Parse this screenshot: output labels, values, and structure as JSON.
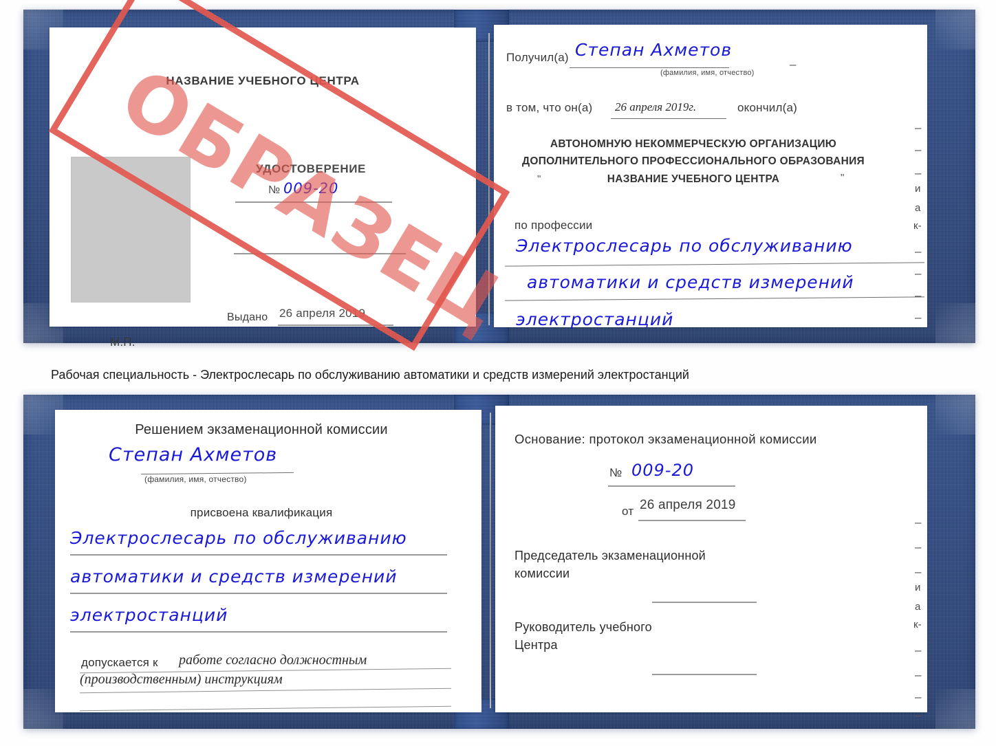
{
  "meta": {
    "stamp_color": "#e2584f",
    "cover_color": "#27478a",
    "ink_color": "#1a1ad6",
    "photo_placeholder_color": "#c9c9c9"
  },
  "stamp": {
    "label": "ОБРАЗЕЦ"
  },
  "certificate_front": {
    "left_page": {
      "center_name": "НАЗВАНИЕ УЧЕБНОГО ЦЕНТРА",
      "doc_type": "УДОСТОВЕРЕНИЕ",
      "number_symbol": "№",
      "number_value": "009-20",
      "issued_label": "Выдано",
      "issued_date": "26 апреля 2019",
      "seal_label": "М.П."
    },
    "right_page": {
      "received_label": "Получил(а)",
      "received_name": "Степан Ахметов",
      "name_hint": "(фамилия, имя, отчество)",
      "that_he_label": "в том, что он(а)",
      "completion_date": "26 апреля 2019г.",
      "finished_label": "окончил(а)",
      "org_line1": "АВТОНОМНУЮ НЕКОММЕРЧЕСКУЮ ОРГАНИЗАЦИЮ",
      "org_line2": "ДОПОЛНИТЕЛЬНОГО ПРОФЕССИОНАЛЬНОГО ОБРАЗОВАНИЯ",
      "org_quote_open": "\"",
      "org_line3": "НАЗВАНИЕ УЧЕБНОГО ЦЕНТРА",
      "org_quote_close": "\"",
      "profession_label": "по профессии",
      "profession_line1": "Электрослесарь по обслуживанию",
      "profession_line2": "автоматики и средств измерений",
      "profession_line3": "электростанций",
      "edge_fragments": [
        "–",
        "–",
        "–",
        "и",
        "а",
        "к-",
        "–",
        "–",
        "–",
        "–"
      ]
    }
  },
  "caption": {
    "text": "Рабочая специальность - Электрослесарь по обслуживанию автоматики и средств измерений электростанций"
  },
  "certificate_back": {
    "left_page": {
      "heading": "Решением экзаменационной комиссии",
      "name": "Степан Ахметов",
      "name_hint": "(фамилия, имя, отчество)",
      "qualification_label": "присвоена квалификация",
      "qualification_line1": "Электрослесарь по обслуживанию",
      "qualification_line2": "автоматики и средств измерений",
      "qualification_line3": "электростанций",
      "admitted_label": "допускается к",
      "admitted_line1": "работе согласно должностным",
      "admitted_line2": "(производственным) инструкциям"
    },
    "right_page": {
      "basis_label": "Основание: протокол экзаменационной комиссии",
      "number_symbol": "№",
      "number_value": "009-20",
      "from_label": "от",
      "from_date": "26 апреля 2019",
      "chairman_line1": "Председатель экзаменационной",
      "chairman_line2": "комиссии",
      "head_line1": "Руководитель учебного",
      "head_line2": "Центра",
      "edge_fragments": [
        "–",
        "–",
        "–",
        "и",
        "а",
        "к-",
        "–",
        "–",
        "–",
        "–"
      ]
    }
  }
}
